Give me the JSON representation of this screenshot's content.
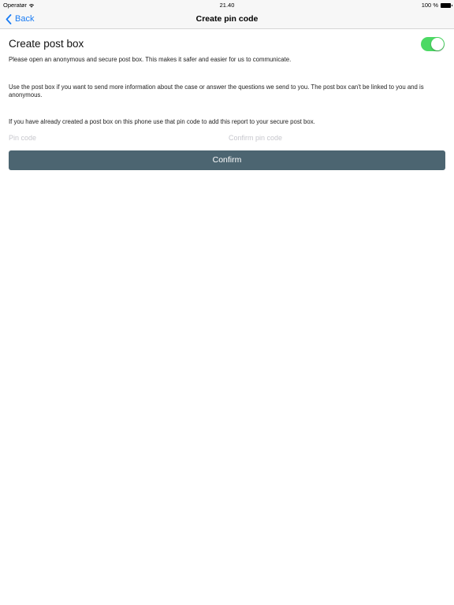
{
  "status_bar": {
    "carrier": "Operatør",
    "time": "21.40",
    "battery": "100 %"
  },
  "nav": {
    "back_label": "Back",
    "title": "Create pin code"
  },
  "main": {
    "section_title": "Create post box",
    "toggle_on": true,
    "paragraph1": "Please open an anonymous and secure post box. This makes it safer and easier for us to communicate.",
    "paragraph2": "Use the post box if you want to send more information about the case or answer the questions we send to you. The post box can't be linked to you and is anonymous.",
    "paragraph3": "If you have already created a post box on this phone use that pin code to add this report to your secure post box.",
    "pin_placeholder": "Pin code",
    "confirm_pin_placeholder": "Confirm pin code",
    "confirm_label": "Confirm"
  },
  "colors": {
    "accent": "#1a7cf4",
    "toggle_on": "#4cd964",
    "button": "#4c6571"
  },
  "icons": {
    "back": "chevron-left-icon",
    "wifi": "wifi-icon",
    "battery": "battery-icon"
  }
}
